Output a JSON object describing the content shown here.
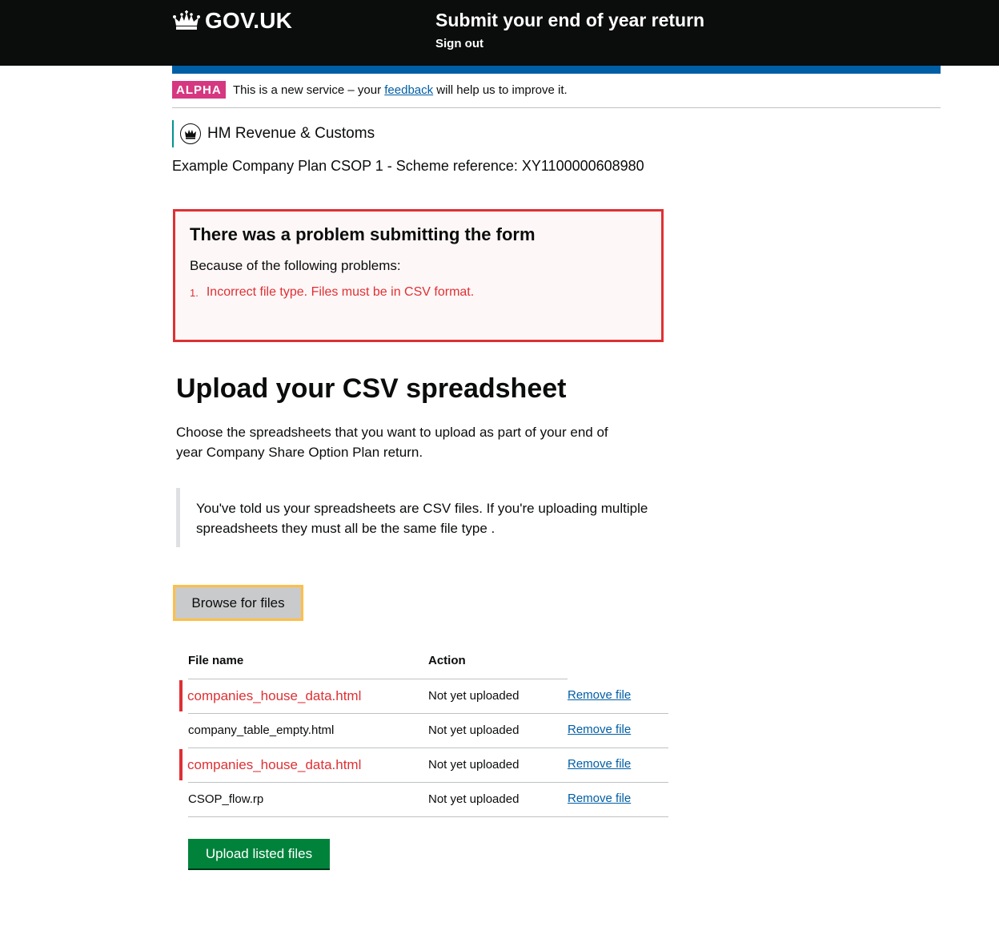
{
  "header": {
    "logo_text": "GOV.UK",
    "service_name": "Submit your end of year return",
    "sign_out": "Sign out"
  },
  "phase_banner": {
    "tag": "ALPHA",
    "text_before": "This is a new service – your ",
    "link": "feedback",
    "text_after": " will help us to improve it."
  },
  "organisation": {
    "name": "HM Revenue & Customs"
  },
  "scheme_reference": "Example Company Plan CSOP 1 - Scheme reference: XY1100000608980",
  "error_summary": {
    "title": "There was a problem submitting the form",
    "subtitle": "Because of the following problems:",
    "errors": [
      {
        "number": "1.",
        "text": "Incorrect file type. Files must be in CSV format."
      }
    ]
  },
  "page": {
    "title": "Upload your CSV spreadsheet",
    "intro": "Choose the spreadsheets that you want to upload as part of your end of year Company Share Option Plan return.",
    "inset": "You've told us your spreadsheets are CSV files. If you're uploading multiple spreadsheets they must all be the same file type ."
  },
  "browse_button": "Browse for files",
  "files_table": {
    "headers": {
      "name": "File name",
      "action": "Action"
    },
    "rows": [
      {
        "name": "companies_house_data.html",
        "status": "Not yet uploaded",
        "action": "Remove file",
        "error": true
      },
      {
        "name": "company_table_empty.html",
        "status": "Not yet uploaded",
        "action": "Remove file",
        "error": false
      },
      {
        "name": "companies_house_data.html",
        "status": "Not yet uploaded",
        "action": "Remove file",
        "error": true
      },
      {
        "name": "CSOP_flow.rp",
        "status": "Not yet uploaded",
        "action": "Remove file",
        "error": false
      }
    ]
  },
  "upload_button": "Upload listed files",
  "colors": {
    "header_bg": "#0b0c0c",
    "blue_bar": "#005ea5",
    "alpha_tag": "#d53880",
    "error": "#df3034",
    "focus": "#ffbf47",
    "button_green": "#00823b",
    "link": "#005ea5",
    "hmrc_line": "#009390"
  }
}
